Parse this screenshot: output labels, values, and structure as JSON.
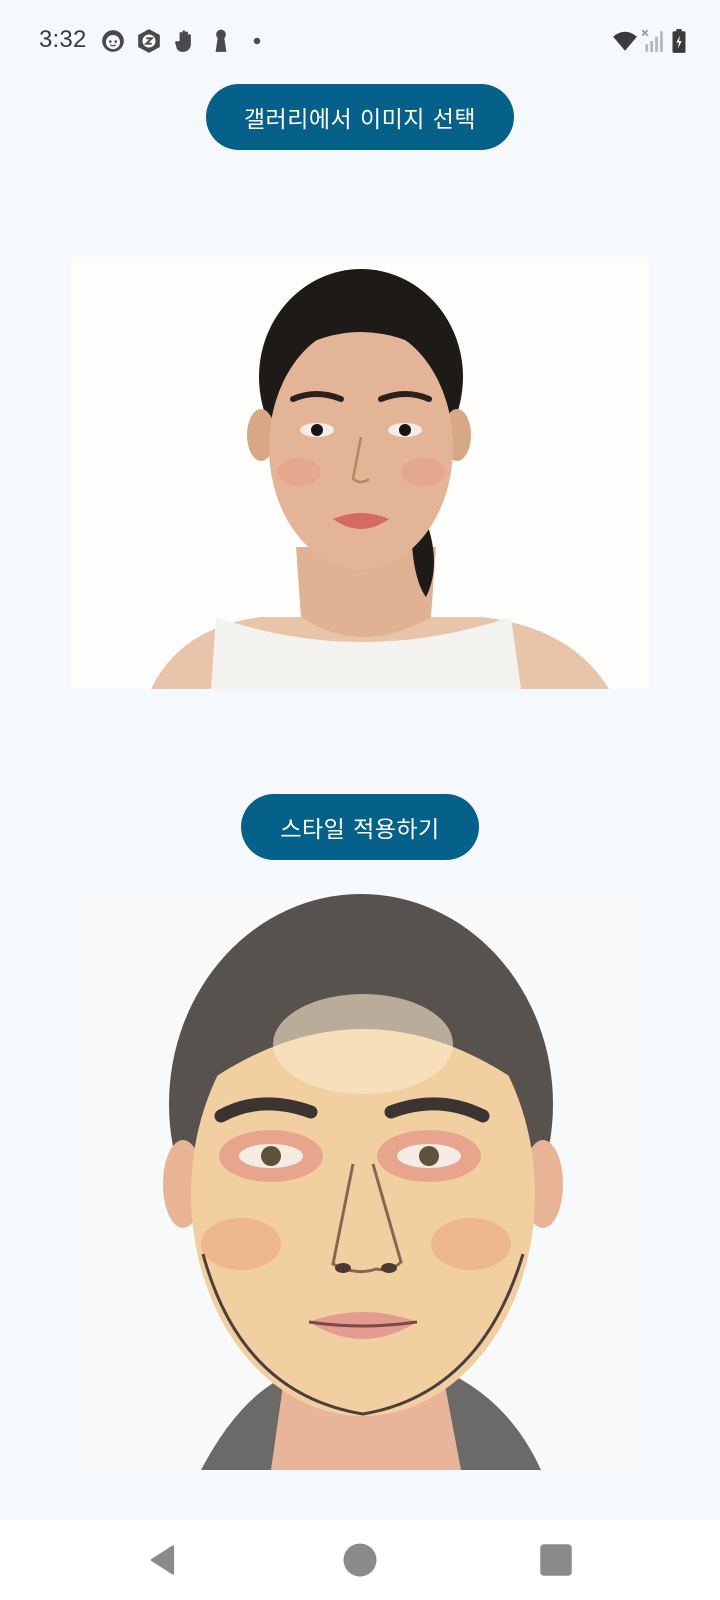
{
  "status_bar": {
    "time": "3:32",
    "notification_icons": [
      "face-icon",
      "z-badge-icon",
      "hand-icon",
      "keyhole-icon",
      "dot-icon"
    ],
    "system_icons": [
      "wifi-icon",
      "cell-signal-off-icon",
      "battery-charging-icon"
    ]
  },
  "main": {
    "gallery_button_label": "갤러리에서 이미지 선택",
    "style_button_label": "스타일 적용하기"
  },
  "colors": {
    "accent": "#06618a",
    "background": "#f5f8fd"
  },
  "nav_bar": {
    "buttons": [
      "back-icon",
      "home-icon",
      "recents-icon"
    ]
  }
}
